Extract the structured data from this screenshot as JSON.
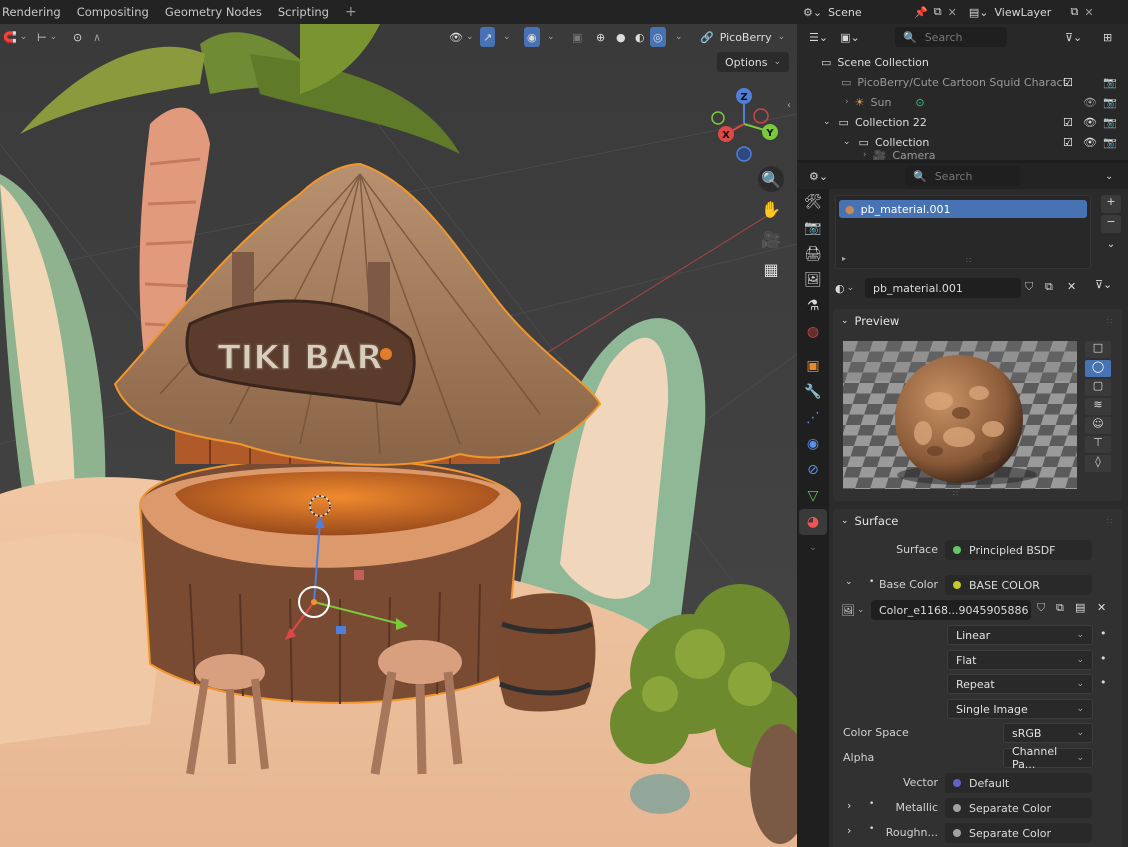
{
  "workspaces": [
    "Rendering",
    "Compositing",
    "Geometry Nodes",
    "Scripting",
    "+"
  ],
  "viewport": {
    "overlay_label": "PicoBerry",
    "options_label": "Options",
    "sign_text": "TIKI BAR",
    "gizmo": {
      "x": "X",
      "y": "Y",
      "z": "Z"
    }
  },
  "topright": {
    "scene": "Scene",
    "viewlayer": "ViewLayer"
  },
  "outliner": {
    "search_placeholder": "Search",
    "rows": [
      {
        "label": "Scene Collection"
      },
      {
        "label": "PicoBerry/Cute Cartoon Squid Charact"
      },
      {
        "label": "Sun"
      },
      {
        "label": "Collection 22"
      },
      {
        "label": "Collection"
      },
      {
        "label": "Camera"
      }
    ]
  },
  "properties": {
    "search_placeholder": "Search",
    "material_slot": "pb_material.001",
    "material_name": "pb_material.001",
    "preview_title": "Preview",
    "surface_title": "Surface",
    "rows": {
      "surface_label": "Surface",
      "surface_value": "Principled BSDF",
      "base_color_label": "Base Color",
      "base_color_value": "BASE COLOR",
      "image_name": "Color_e1168...9045905886",
      "interpolation": "Linear",
      "projection": "Flat",
      "extension": "Repeat",
      "source": "Single Image",
      "color_space_label": "Color Space",
      "color_space_value": "sRGB",
      "alpha_label": "Alpha",
      "alpha_value": "Channel Pa...",
      "vector_label": "Vector",
      "vector_value": "Default",
      "metallic_label": "Metallic",
      "metallic_value": "Separate Color",
      "roughness_label": "Roughn...",
      "roughness_value": "Separate Color"
    }
  },
  "colors": {
    "accent": "#4772b3",
    "selection_outline": "#f0962c",
    "socket_yellow": "#c7c729",
    "socket_green": "#63c763",
    "socket_grey": "#a1a1a1",
    "socket_blue": "#6363c7"
  }
}
